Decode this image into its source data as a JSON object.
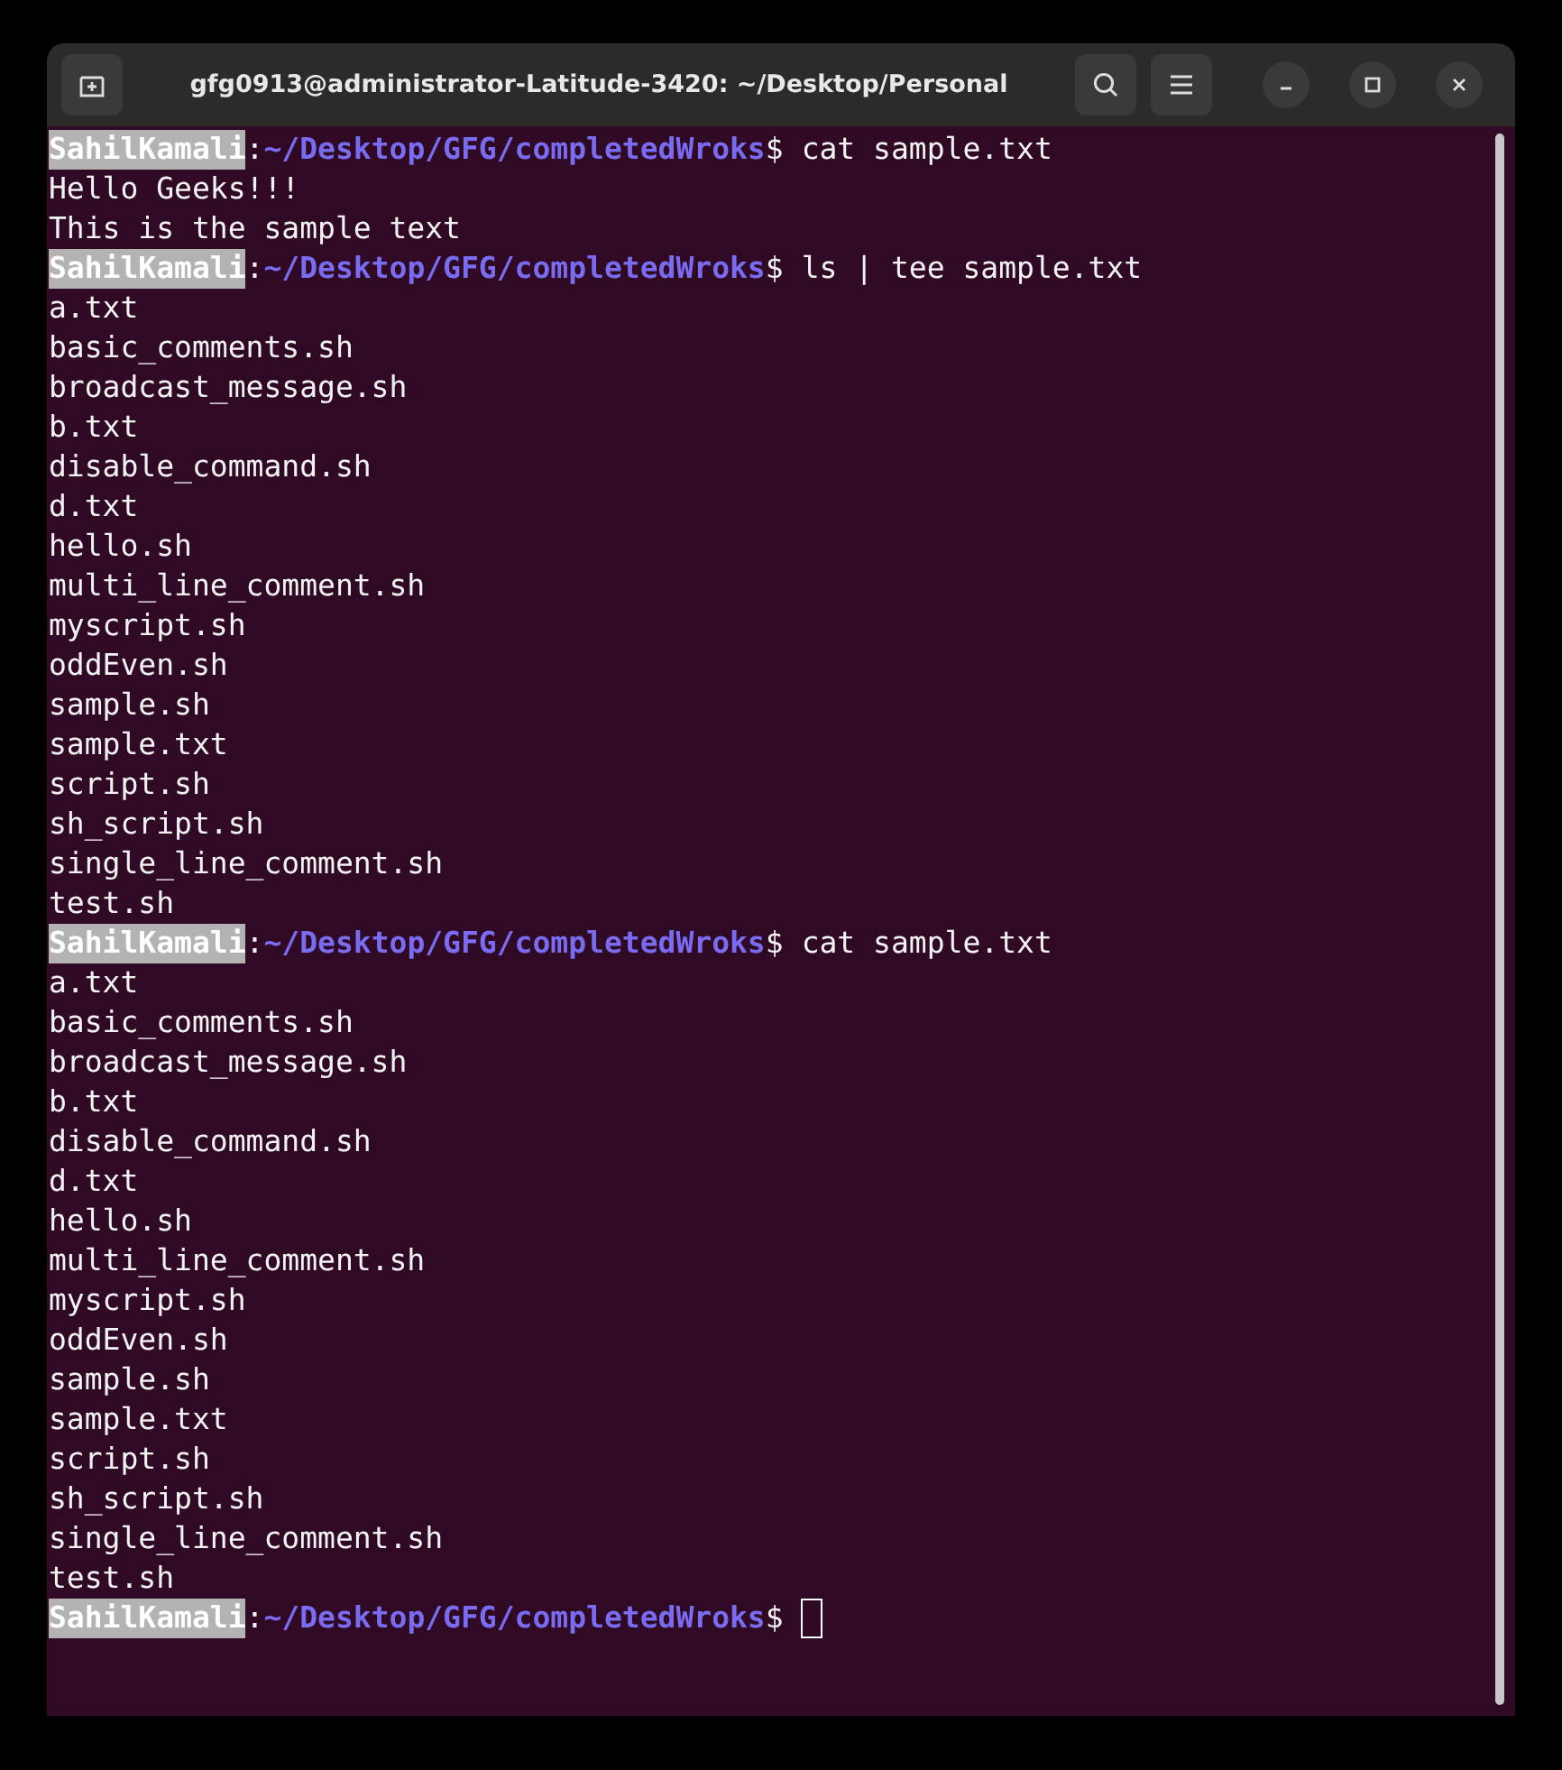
{
  "window": {
    "title": "gfg0913@administrator-Latitude-3420: ~/Desktop/Personal"
  },
  "lines": [
    {
      "kind": "prompt",
      "user": "SahilKamali",
      "separator": ":",
      "path": "~/Desktop/GFG/completedWroks",
      "symbol": "$",
      "command": "cat sample.txt",
      "cursor": false
    },
    {
      "kind": "output",
      "text": "Hello Geeks!!!"
    },
    {
      "kind": "output",
      "text": "This is the sample text"
    },
    {
      "kind": "prompt",
      "user": "SahilKamali",
      "separator": ":",
      "path": "~/Desktop/GFG/completedWroks",
      "symbol": "$",
      "command": "ls | tee sample.txt",
      "cursor": false
    },
    {
      "kind": "output",
      "text": "a.txt"
    },
    {
      "kind": "output",
      "text": "basic_comments.sh"
    },
    {
      "kind": "output",
      "text": "broadcast_message.sh"
    },
    {
      "kind": "output",
      "text": "b.txt"
    },
    {
      "kind": "output",
      "text": "disable_command.sh"
    },
    {
      "kind": "output",
      "text": "d.txt"
    },
    {
      "kind": "output",
      "text": "hello.sh"
    },
    {
      "kind": "output",
      "text": "multi_line_comment.sh"
    },
    {
      "kind": "output",
      "text": "myscript.sh"
    },
    {
      "kind": "output",
      "text": "oddEven.sh"
    },
    {
      "kind": "output",
      "text": "sample.sh"
    },
    {
      "kind": "output",
      "text": "sample.txt"
    },
    {
      "kind": "output",
      "text": "script.sh"
    },
    {
      "kind": "output",
      "text": "sh_script.sh"
    },
    {
      "kind": "output",
      "text": "single_line_comment.sh"
    },
    {
      "kind": "output",
      "text": "test.sh"
    },
    {
      "kind": "prompt",
      "user": "SahilKamali",
      "separator": ":",
      "path": "~/Desktop/GFG/completedWroks",
      "symbol": "$",
      "command": "cat sample.txt",
      "cursor": false
    },
    {
      "kind": "output",
      "text": "a.txt"
    },
    {
      "kind": "output",
      "text": "basic_comments.sh"
    },
    {
      "kind": "output",
      "text": "broadcast_message.sh"
    },
    {
      "kind": "output",
      "text": "b.txt"
    },
    {
      "kind": "output",
      "text": "disable_command.sh"
    },
    {
      "kind": "output",
      "text": "d.txt"
    },
    {
      "kind": "output",
      "text": "hello.sh"
    },
    {
      "kind": "output",
      "text": "multi_line_comment.sh"
    },
    {
      "kind": "output",
      "text": "myscript.sh"
    },
    {
      "kind": "output",
      "text": "oddEven.sh"
    },
    {
      "kind": "output",
      "text": "sample.sh"
    },
    {
      "kind": "output",
      "text": "sample.txt"
    },
    {
      "kind": "output",
      "text": "script.sh"
    },
    {
      "kind": "output",
      "text": "sh_script.sh"
    },
    {
      "kind": "output",
      "text": "single_line_comment.sh"
    },
    {
      "kind": "output",
      "text": "test.sh"
    },
    {
      "kind": "prompt",
      "user": "SahilKamali",
      "separator": ":",
      "path": "~/Desktop/GFG/completedWroks",
      "symbol": "$",
      "cursor": true
    }
  ]
}
